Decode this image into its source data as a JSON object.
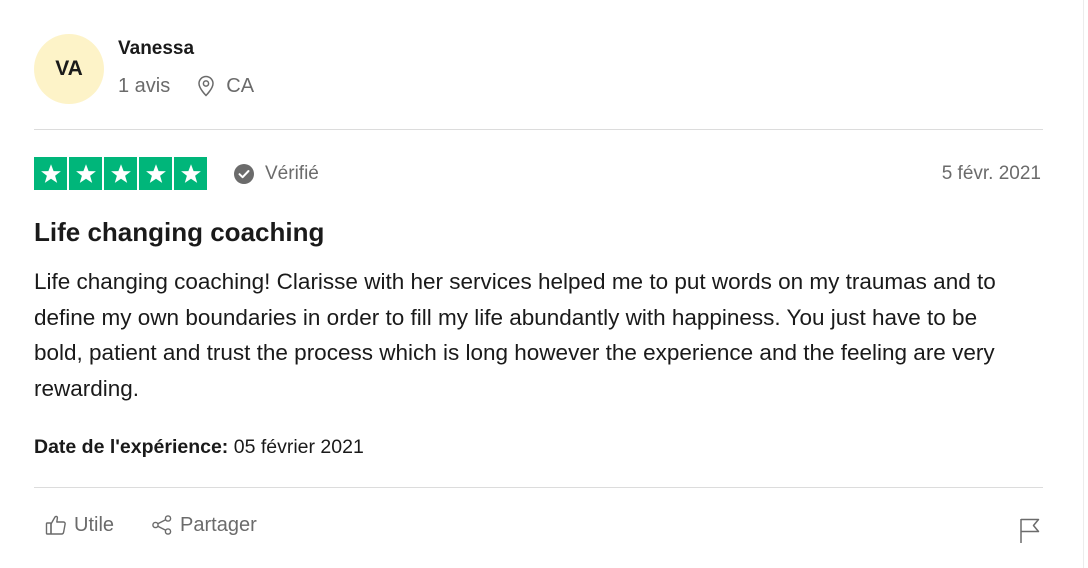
{
  "consumer": {
    "initials": "VA",
    "name": "Vanessa",
    "review_count": "1 avis",
    "country": "CA",
    "avatar_color": "#fdf3c8"
  },
  "review": {
    "rating": 5,
    "max_rating": 5,
    "star_color": "#00b67a",
    "verified_label": "Vérifié",
    "date": "5 févr. 2021",
    "title": "Life changing coaching",
    "body": "Life changing coaching! Clarisse with her services helped me to put words on my traumas and to define my own boundaries in order to fill my life abundantly with happiness. You just have to be bold, patient and trust the process which is long however the experience and the feeling are very rewarding.",
    "experience_label": "Date de l'expérience:",
    "experience_date": "05 février 2021"
  },
  "actions": {
    "useful_label": "Utile",
    "share_label": "Partager",
    "icons": [
      "thumbs-up-icon",
      "share-icon",
      "flag-icon"
    ]
  }
}
